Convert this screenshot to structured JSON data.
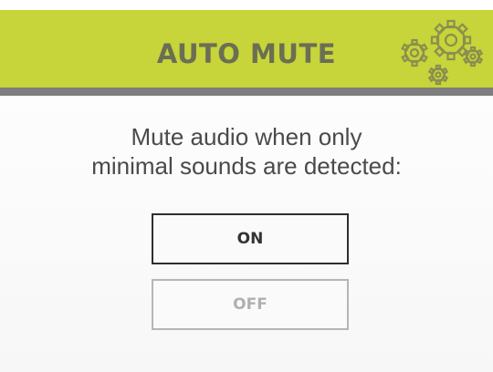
{
  "header": {
    "title": "AUTO MUTE",
    "settings_icon": "gears-icon",
    "bg_color": "#c7d43a",
    "divider_color": "#7d7d7d"
  },
  "prompt": {
    "line1": "Mute audio when only",
    "line2": "minimal sounds are detected:"
  },
  "options": {
    "on_label": "ON",
    "off_label": "OFF",
    "selected": "ON"
  }
}
